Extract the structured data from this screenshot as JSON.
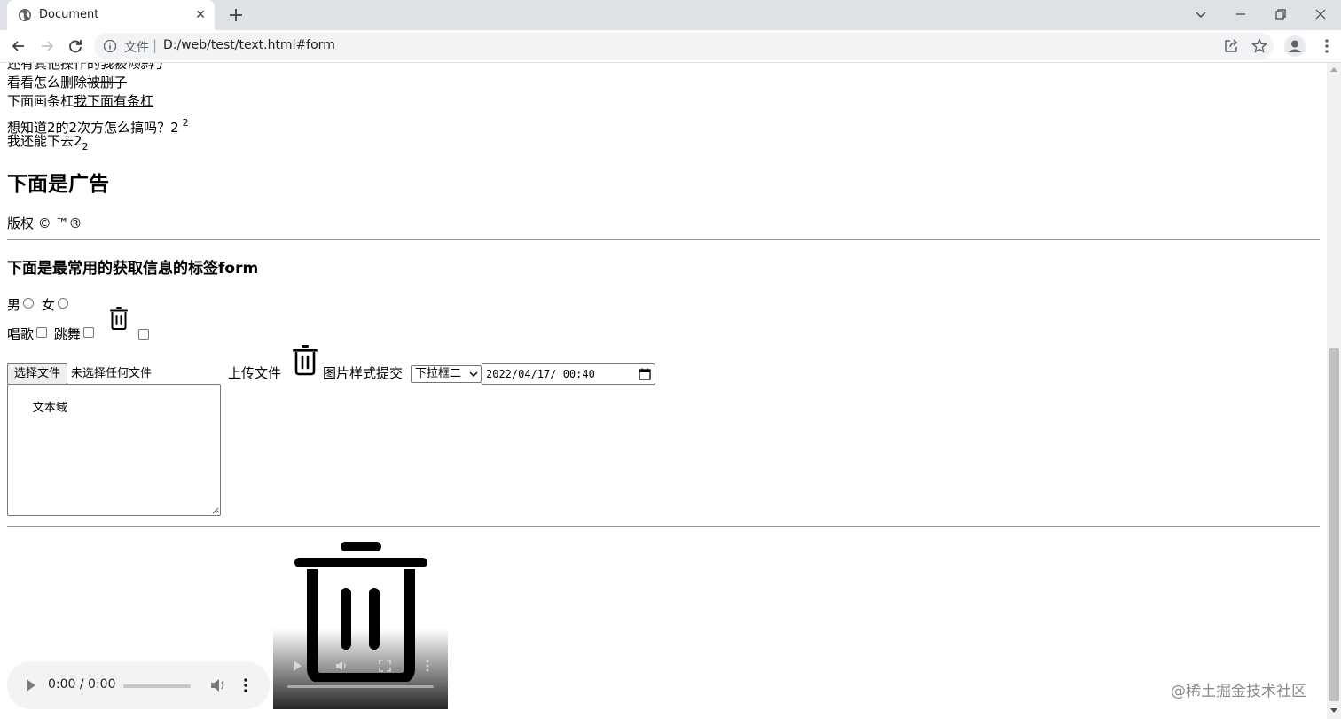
{
  "browser": {
    "tab_title": "Document",
    "tab_close": "✕",
    "omnibox_scheme": "文件",
    "omnibox_separator": "|",
    "url": "D:/web/test/text.html#form"
  },
  "content": {
    "line1_prefix": "还有其他操作的",
    "line1_italic": "我被倾斜了",
    "line2_prefix": "看看怎么删除",
    "line2_strike": "被删子",
    "line3_prefix": "下面画条杠",
    "line3_underline": "我下面有条杠",
    "line4_text": "想知道2的2次方怎么搞吗？2",
    "line4_sup": "2",
    "line5_text": "我还能下去2",
    "line5_sub": "2",
    "ad_heading": "下面是广告",
    "copyright": "版权 © ™®"
  },
  "form": {
    "title": "下面是最常用的获取信息的标签form",
    "radio_male": "男",
    "radio_female": "女",
    "check_sing": "唱歌",
    "check_dance": "跳舞",
    "file_button": "选择文件",
    "file_status": "未选择任何文件",
    "upload_label": "上传文件",
    "image_submit_label": "图片样式提交",
    "select_value": "下拉框二",
    "datetime_value": "2022/04/17/ 00:40",
    "textarea_value": "文本域"
  },
  "media": {
    "audio_time": "0:00 / 0:00"
  },
  "watermark": "@稀土掘金技术社区",
  "icons": {
    "tab": "globe-icon",
    "trash": "trash-icon",
    "calendar": "calendar-icon"
  }
}
